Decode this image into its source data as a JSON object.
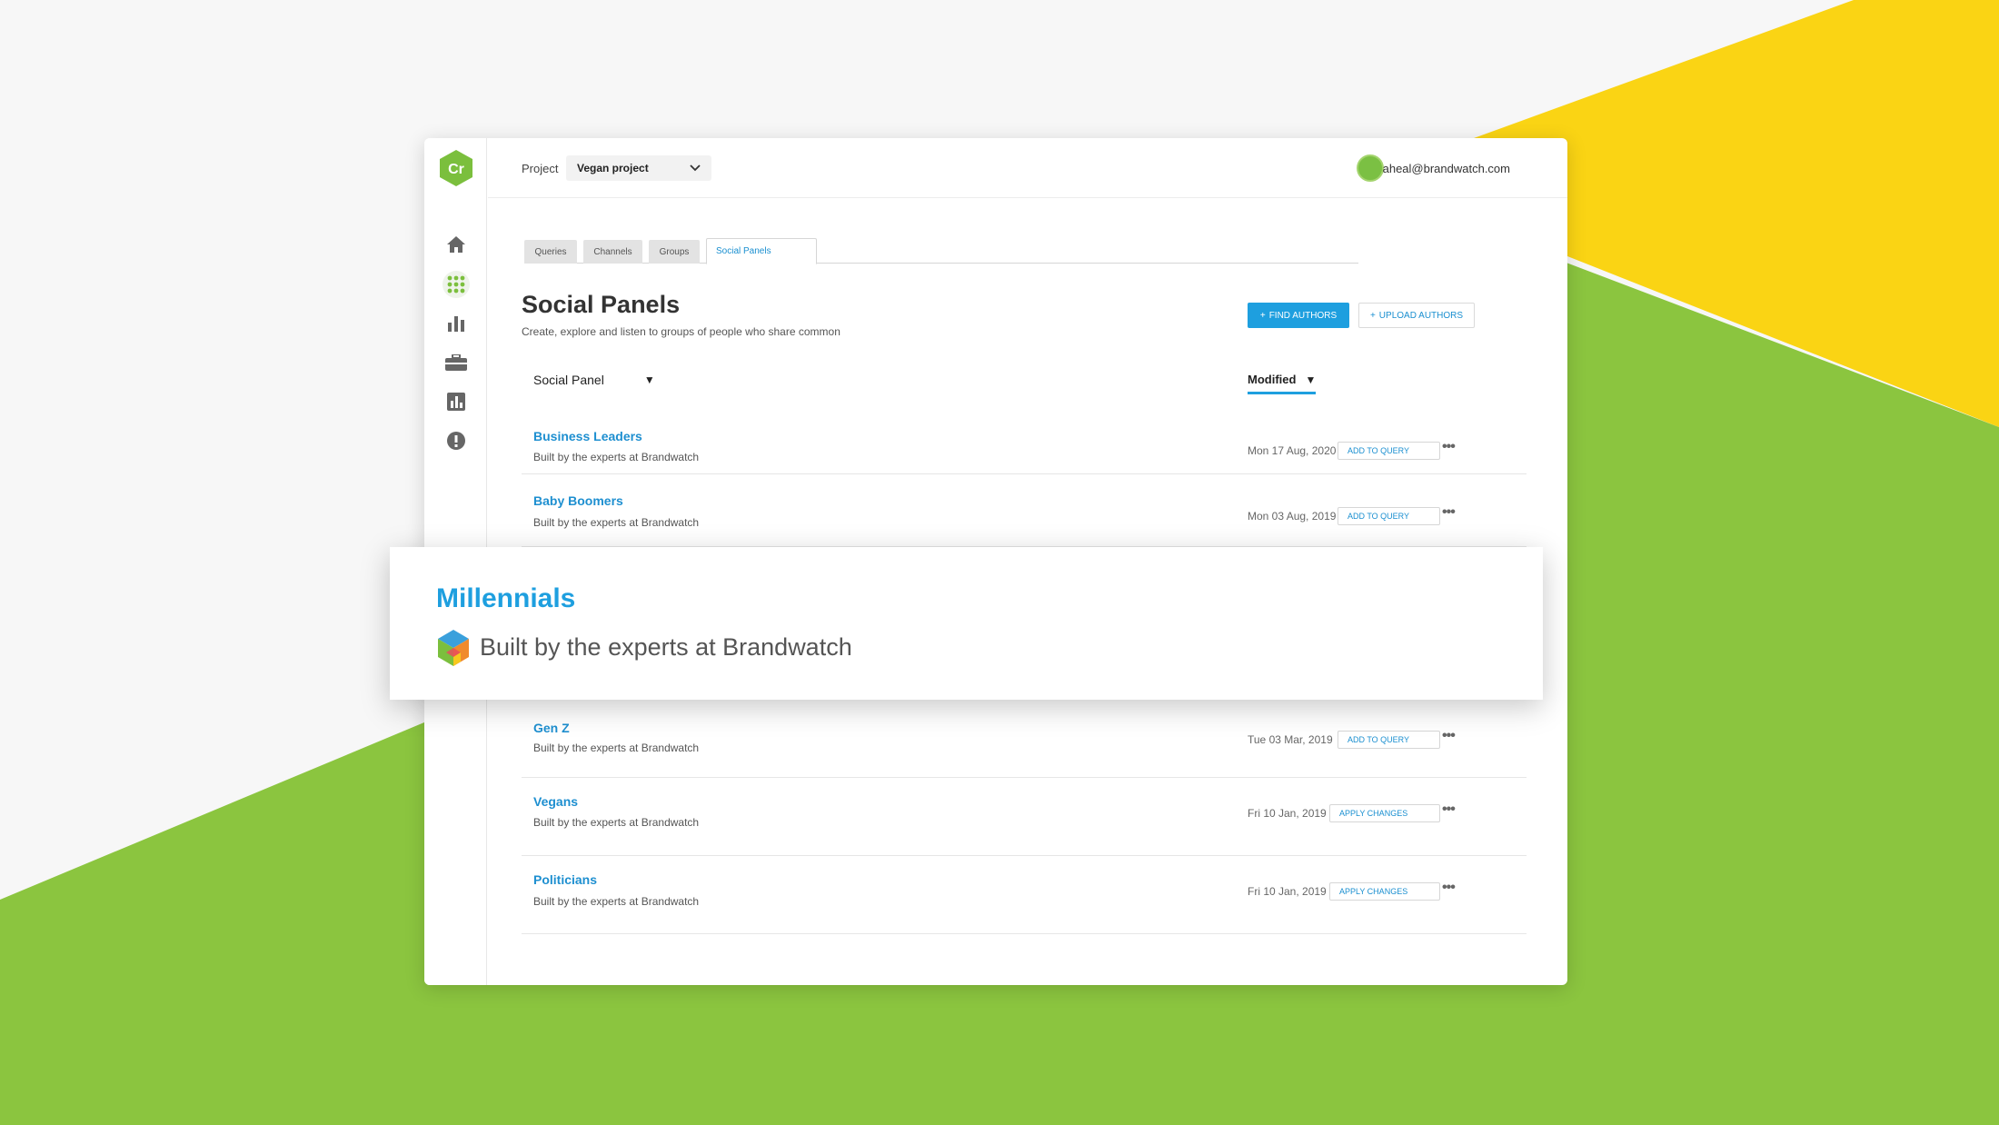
{
  "colors": {
    "accent": "#1e9fdf",
    "brand_green": "#8bc53f",
    "brand_yellow": "#fad414"
  },
  "app": {
    "logo_text": "Cr"
  },
  "sidebar": {
    "items": [
      {
        "icon": "home-icon"
      },
      {
        "icon": "apps-grid-icon",
        "active": true
      },
      {
        "icon": "bar-chart-icon"
      },
      {
        "icon": "briefcase-icon"
      },
      {
        "icon": "report-chart-icon"
      },
      {
        "icon": "alert-icon"
      }
    ]
  },
  "topbar": {
    "project_label": "Project",
    "project_value": "Vegan project",
    "user_email": "aheal@brandwatch.com"
  },
  "tabs": [
    {
      "label": "Queries"
    },
    {
      "label": "Channels"
    },
    {
      "label": "Groups"
    },
    {
      "label": "Social Panels",
      "active": true
    }
  ],
  "page": {
    "title": "Social Panels",
    "subtitle": "Create, explore and listen to groups of people who share common",
    "find_authors": "FIND AUTHORS",
    "upload_authors": "UPLOAD AUTHORS"
  },
  "table": {
    "col_panel": "Social Panel",
    "col_modified": "Modified",
    "rows": [
      {
        "name": "Business Leaders",
        "desc": "Built by the experts at Brandwatch",
        "date": "Mon 17 Aug, 2020",
        "action": "ADD TO QUERY"
      },
      {
        "name": "Baby Boomers",
        "desc": "Built by the experts at Brandwatch",
        "date": "Mon 03 Aug, 2019",
        "action": "ADD TO QUERY"
      },
      {
        "name": "Gen Z",
        "desc": "Built by the experts at Brandwatch",
        "date": "Tue 03 Mar, 2019",
        "action": "ADD TO QUERY"
      },
      {
        "name": "Vegans",
        "desc": "Built by the experts at Brandwatch",
        "date": "Fri 10 Jan, 2019",
        "action": "APPLY CHANGES"
      },
      {
        "name": "Politicians",
        "desc": "Built by the experts at Brandwatch",
        "date": "Fri 10 Jan, 2019",
        "action": "APPLY CHANGES"
      }
    ]
  },
  "highlight": {
    "name": "Millennials",
    "desc": "Built by the experts at Brandwatch"
  }
}
